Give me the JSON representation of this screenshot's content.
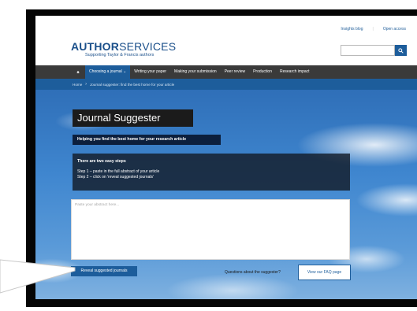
{
  "header": {
    "logo_prefix": "AUTHOR",
    "logo_suffix": "SERVICES",
    "logo_tagline": "Supporting Taylor & Francis authors",
    "top_links": [
      "Insights blog",
      "Open access"
    ],
    "search_icon": "search-icon"
  },
  "nav": {
    "home_icon": "home-icon",
    "items": [
      {
        "label": "Choosing a journal ⌄",
        "active": true
      },
      {
        "label": "Writing your paper",
        "active": false
      },
      {
        "label": "Making your submission",
        "active": false
      },
      {
        "label": "Peer review",
        "active": false
      },
      {
        "label": "Production",
        "active": false
      },
      {
        "label": "Research impact",
        "active": false
      }
    ]
  },
  "breadcrumb": {
    "home": "Home",
    "separator": "›",
    "current": "Journal suggester: find the best home for your article"
  },
  "hero": {
    "title": "Journal Suggester",
    "subtitle": "Helping you find the best home for your research article",
    "steps_title": "There are two easy steps",
    "step1": "Step 1 – paste in the full abstract of your article",
    "step2": "Step 2 – click on 'reveal suggested journals'"
  },
  "form": {
    "abstract_placeholder": "Paste your abstract here...",
    "reveal_button": "Reveal suggested journals",
    "question_text": "Questions about the suggester?",
    "faq_button": "View our FAQ page"
  },
  "colors": {
    "brand_blue": "#1d5d9b",
    "nav_bg": "#3a3a3a",
    "title_bg": "#1b1b1b"
  }
}
